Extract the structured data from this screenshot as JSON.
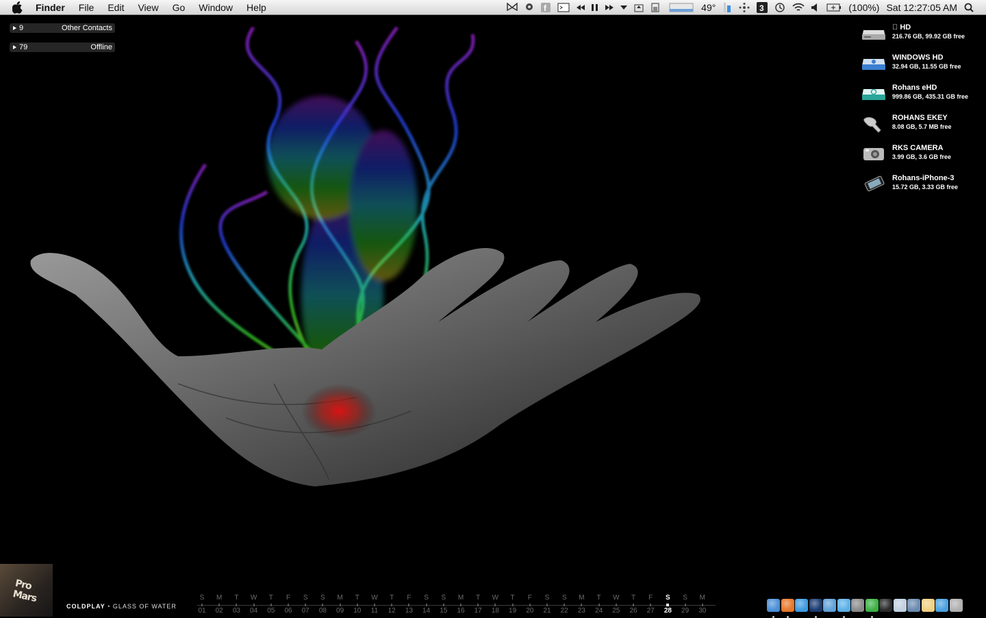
{
  "menubar": {
    "apple_icon": "apple-logo",
    "app_name": "Finder",
    "menus": [
      "File",
      "Edit",
      "View",
      "Go",
      "Window",
      "Help"
    ],
    "status": {
      "temperature": "49°",
      "battery": "(100%)",
      "clock": "Sat 12:27:05 AM"
    }
  },
  "contacts": [
    {
      "count": "9",
      "label": "Other Contacts"
    },
    {
      "count": "79",
      "label": "Offline"
    }
  ],
  "drives": [
    {
      "name": "HD",
      "info": "216.76 GB, 99.92 GB free",
      "icon": "internal-drive-icon"
    },
    {
      "name": "WINDOWS HD",
      "info": "32.94 GB, 11.55 GB free",
      "icon": "windows-drive-icon"
    },
    {
      "name": "Rohans eHD",
      "info": "999.86 GB, 435.31 GB free",
      "icon": "external-drive-icon"
    },
    {
      "name": "ROHANS EKEY",
      "info": "8.08 GB, 5.7 MB free",
      "icon": "usb-key-icon"
    },
    {
      "name": "RKS CAMERA",
      "info": "3.99 GB, 3.6 GB free",
      "icon": "camera-icon"
    },
    {
      "name": "Rohans-iPhone-3",
      "info": "15.72 GB, 3.33 GB free",
      "icon": "iphone-icon"
    }
  ],
  "now_playing": {
    "artist": "COLDPLAY",
    "separator": "•",
    "track": "GLASS OF WATER",
    "album_art_text": "Pro Mars"
  },
  "calendar": {
    "days": [
      {
        "l": "S",
        "n": "01"
      },
      {
        "l": "M",
        "n": "02"
      },
      {
        "l": "T",
        "n": "03"
      },
      {
        "l": "W",
        "n": "04"
      },
      {
        "l": "T",
        "n": "05"
      },
      {
        "l": "F",
        "n": "06"
      },
      {
        "l": "S",
        "n": "07"
      },
      {
        "l": "S",
        "n": "08"
      },
      {
        "l": "M",
        "n": "09"
      },
      {
        "l": "T",
        "n": "10"
      },
      {
        "l": "W",
        "n": "11"
      },
      {
        "l": "T",
        "n": "12"
      },
      {
        "l": "F",
        "n": "13"
      },
      {
        "l": "S",
        "n": "14"
      },
      {
        "l": "S",
        "n": "15"
      },
      {
        "l": "M",
        "n": "16"
      },
      {
        "l": "T",
        "n": "17"
      },
      {
        "l": "W",
        "n": "18"
      },
      {
        "l": "T",
        "n": "19"
      },
      {
        "l": "F",
        "n": "20"
      },
      {
        "l": "S",
        "n": "21"
      },
      {
        "l": "S",
        "n": "22"
      },
      {
        "l": "M",
        "n": "23"
      },
      {
        "l": "T",
        "n": "24"
      },
      {
        "l": "W",
        "n": "25"
      },
      {
        "l": "T",
        "n": "26"
      },
      {
        "l": "F",
        "n": "27"
      },
      {
        "l": "S",
        "n": "28"
      },
      {
        "l": "S",
        "n": "29"
      },
      {
        "l": "M",
        "n": "30"
      }
    ],
    "today": "28"
  },
  "dock": [
    {
      "name": "finder-icon",
      "color": "#4a8fd8",
      "running": true
    },
    {
      "name": "firefox-icon",
      "color": "#e8772a",
      "running": true
    },
    {
      "name": "safari-icon",
      "color": "#3d9be0",
      "running": false
    },
    {
      "name": "photoshop-icon",
      "color": "#1a3a70",
      "running": true
    },
    {
      "name": "mail-icon",
      "color": "#5fa0d8",
      "running": false
    },
    {
      "name": "itunes-icon",
      "color": "#5ab0e8",
      "running": true
    },
    {
      "name": "adium-icon",
      "color": "#8a8a8a",
      "running": false
    },
    {
      "name": "utorrent-icon",
      "color": "#3cb044",
      "running": true
    },
    {
      "name": "terminal-icon",
      "color": "#2a2a2a",
      "running": false
    },
    {
      "name": "bottle-icon",
      "color": "#c0d0e0",
      "running": false
    },
    {
      "name": "preview-icon",
      "color": "#6a8ab0",
      "running": false
    },
    {
      "name": "notes-icon",
      "color": "#f0d080",
      "running": false
    },
    {
      "name": "downloads-icon",
      "color": "#4aa0e0",
      "running": false
    },
    {
      "name": "trash-icon",
      "color": "#b0b0b0",
      "running": false
    }
  ]
}
